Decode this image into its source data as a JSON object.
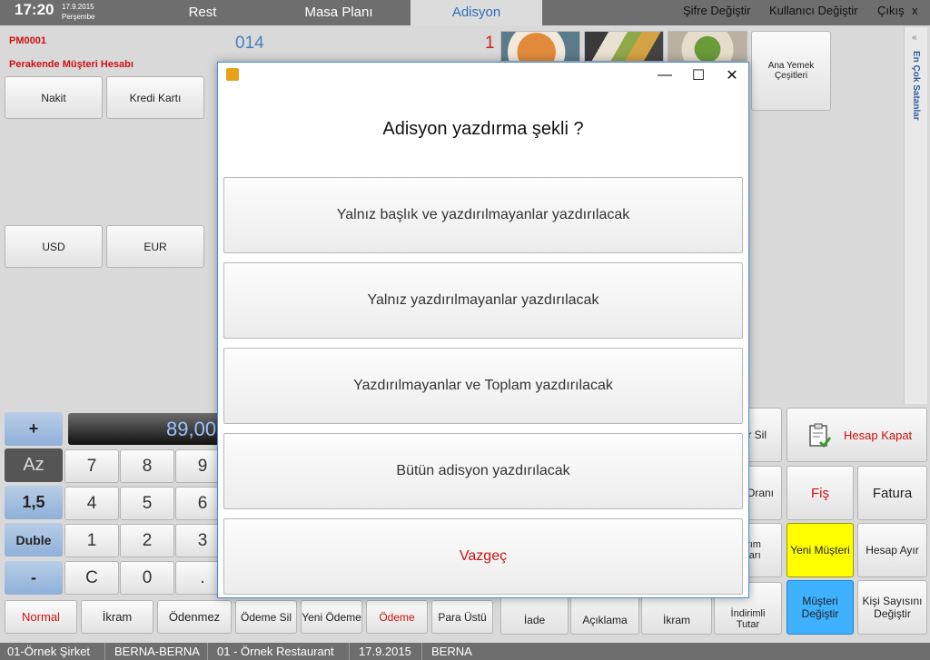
{
  "header": {
    "time": "17:20",
    "date": "17.9.2015",
    "weekday": "Perşembe",
    "tabs": [
      {
        "label": "Rest"
      },
      {
        "label": "Masa Planı"
      },
      {
        "label": "Adisyon"
      }
    ],
    "links": [
      "Şifre Değiştir",
      "Kullanıcı Değiştir",
      "Çıkış",
      "x"
    ]
  },
  "account": {
    "code": "PM0001",
    "name": "Perakende Müşteri Hesabı",
    "table_no": "014",
    "quantity": "1"
  },
  "payment_buttons": [
    "Nakit",
    "Kredi Kartı",
    "USD",
    "EUR"
  ],
  "category_button": "Ana Yemek Çeşitleri",
  "sidebar_label": "En Çok Satanlar",
  "calculator": {
    "display": "89,00",
    "plus": "+",
    "az": "Az",
    "one_five": "1,5",
    "duble": "Duble",
    "minus": "-",
    "keys": [
      "7",
      "8",
      "9",
      "4",
      "5",
      "6",
      "1",
      "2",
      "3",
      "C",
      "0",
      "."
    ]
  },
  "bottom_buttons": [
    "Normal",
    "İkram",
    "Ödenmez",
    "Ödeme Sil",
    "Yeni Ödeme",
    "Ödeme",
    "Para Üstü"
  ],
  "right_buttons": {
    "hesap_kapat": "Hesap Kapat",
    "fis": "Fiş",
    "fatura": "Fatura",
    "yeni_musteri": "Yeni Müşteri",
    "hesap_ayir": "Hesap Ayır",
    "musteri_degistir": "Müşteri Değiştir",
    "kisi_sayisi": "Kişi Sayısını Değiştir",
    "partial": [
      "r Sil",
      "Oranı",
      "rım ları"
    ],
    "iade": "İade",
    "aciklama": "Açıklama",
    "ikram": "İkram",
    "indirimli_tutar": "İndirimli Tutar"
  },
  "status": [
    "01-Örnek Şirket",
    "BERNA-BERNA",
    "01 - Örnek Restaurant",
    "17.9.2015",
    "BERNA"
  ],
  "dialog": {
    "question": "Adisyon yazdırma şekli ?",
    "options": [
      "Yalnız başlık ve yazdırılmayanlar yazdırılacak",
      "Yalnız yazdırılmayanlar yazdırılacak",
      "Yazdırılmayanlar ve Toplam yazdırılacak",
      "Bütün adisyon yazdırılacak"
    ],
    "cancel": "Vazgeç",
    "minimize": "—",
    "maximize": "☐",
    "close": "✕"
  },
  "colors": {
    "accent_blue": "#2e6fb5",
    "red_text": "#cc1111",
    "yellow": "#ffff00",
    "cyan": "#3eb1ff"
  }
}
